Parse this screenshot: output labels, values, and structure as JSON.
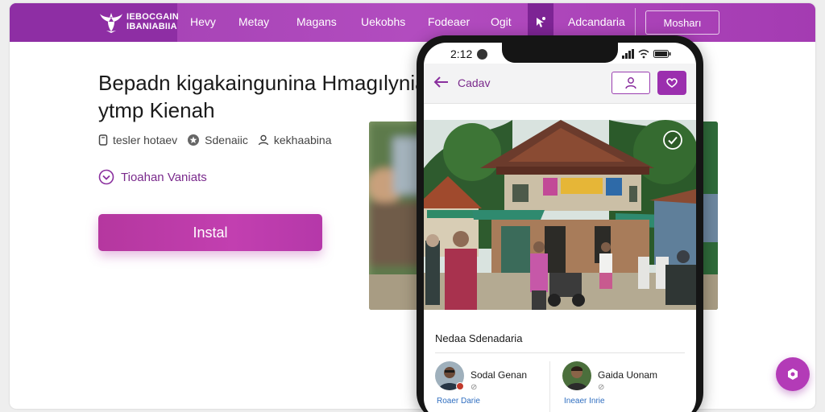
{
  "brand": {
    "line1": "IEBOCGAIN",
    "line2": "IBANIABIIA"
  },
  "nav": {
    "items": [
      "Hevy",
      "Metay",
      "Magans",
      "Uekobhs",
      "Fodeaer",
      "Ogit"
    ],
    "highlight_label": "Adcandaria",
    "button_label": "Mosharı"
  },
  "hero": {
    "headline_line1": "Bepadn kigakaingunina Hmagılynia",
    "headline_line2": "ytmp Kienah",
    "meta": [
      {
        "icon": "device-icon",
        "label": "tesler hotaev"
      },
      {
        "icon": "star-badge-icon",
        "label": "Sdenaiic"
      },
      {
        "icon": "person-icon",
        "label": "kekhaabina"
      }
    ],
    "feature_label": "Tioahan Vaniats",
    "install_label": "Instal"
  },
  "phone": {
    "status_time": "2:12",
    "app_title": "Cadav",
    "section_title": "Nedaa Sdenadaria",
    "contacts": [
      {
        "name": "Sodal Genan",
        "sub": "⊘",
        "link": "Roaer Darie"
      },
      {
        "name": "Gaida Uonam",
        "sub": "⊘",
        "link": "Ineaer Inrie"
      }
    ]
  },
  "colors": {
    "brand_purple": "#a13fb1",
    "brand_dark": "#8e2ea4",
    "accent": "#b33bb7",
    "link": "#2f6ec0"
  }
}
